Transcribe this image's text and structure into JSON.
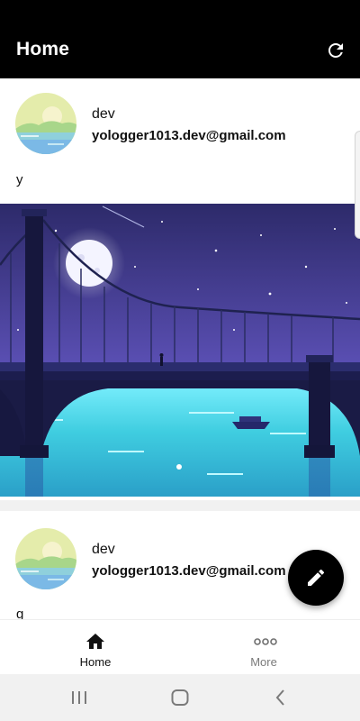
{
  "app_bar": {
    "title": "Home",
    "refresh_icon": "refresh-icon"
  },
  "posts": [
    {
      "author": "dev",
      "email": "yologger1013.dev@gmail.com",
      "text": "y",
      "has_image": true,
      "image_subject": "night-bridge-illustration"
    },
    {
      "author": "dev",
      "email": "yologger1013.dev@gmail.com",
      "text": "g"
    }
  ],
  "fab": {
    "icon": "pencil-icon"
  },
  "bottom_nav": {
    "items": [
      {
        "label": "Home",
        "icon": "home-icon",
        "selected": true
      },
      {
        "label": "More",
        "icon": "more-dots-icon",
        "selected": false
      }
    ]
  },
  "system_nav": {
    "buttons": [
      "recents-icon",
      "home-circle-icon",
      "back-icon"
    ]
  },
  "colors": {
    "app_bar_bg": "#000000",
    "fab_bg": "#000000",
    "selected_nav": "#111111",
    "unselected_nav": "#7a7a7a"
  }
}
